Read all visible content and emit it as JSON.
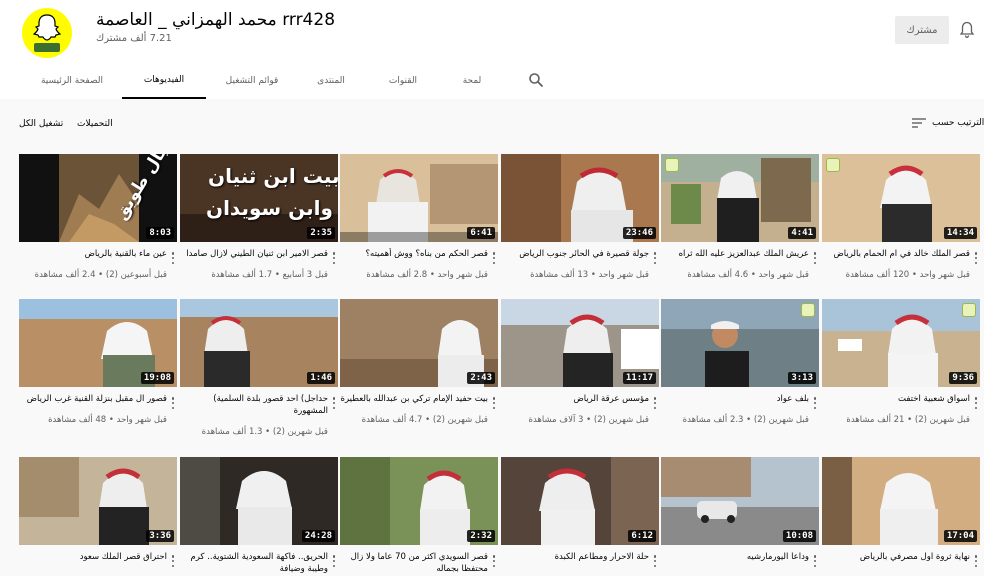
{
  "channel": {
    "name": "rrr428 محمد الهمزاني _ العاصمة",
    "subscribers": "7.21 ألف مشترك",
    "subscribe_label": "مشترك"
  },
  "tabs": [
    {
      "label": "الصفحة الرئيسية",
      "active": false
    },
    {
      "label": "الفيديوهات",
      "active": true
    },
    {
      "label": "قوائم التشغيل",
      "active": false
    },
    {
      "label": "المنتدى",
      "active": false
    },
    {
      "label": "القنوات",
      "active": false
    },
    {
      "label": "لمحة",
      "active": false
    }
  ],
  "toolbar": {
    "uploads_label": "التحميلات",
    "play_all_label": "تشغيل الكل",
    "sort_label": "الترتيب حسب"
  },
  "videos": [
    {
      "title": "عين ماء بالقنية بالرياض",
      "views": "2.4 ألف مشاهدة",
      "age": "قبل أسبوعين (2)",
      "duration": "8:03"
    },
    {
      "title": "قصر الامير ابن ثنيان الطيني لازال صامدا",
      "views": "1.7 ألف مشاهدة",
      "age": "قبل 3 أسابيع",
      "duration": "2:35"
    },
    {
      "title": "قصر الحكم من بناه؟ ووش أهميته؟",
      "views": "2.8 ألف مشاهدة",
      "age": "قبل شهر واحد",
      "duration": "6:41"
    },
    {
      "title": "جولة قصيرة في الحائر جنوب الرياض",
      "views": "13 ألف مشاهدة",
      "age": "قبل شهر واحد",
      "duration": "23:46"
    },
    {
      "title": "عريش الملك عبدالعزيز عليه الله ثراه",
      "views": "4.6 ألف مشاهدة",
      "age": "قبل شهر واحد",
      "duration": "4:41"
    },
    {
      "title": "قصر الملك خالد في ام الحمام بالرياض",
      "views": "120 ألف مشاهدة",
      "age": "قبل شهر واحد",
      "duration": "14:34"
    },
    {
      "title": "قصور ال مقبل بنزلة القنية غرب الرياض",
      "views": "48 ألف مشاهدة",
      "age": "قبل شهر واحد",
      "duration": "19:08"
    },
    {
      "title": "حداجل) احد قصور بلدة السلمية) المشهورة",
      "views": "1.3 ألف مشاهدة",
      "age": "قبل شهرين (2)",
      "duration": "1:46"
    },
    {
      "title": "بيت حفيد الإمام تركي بن عبدالله بالعطيرة",
      "views": "4.7 ألف مشاهدة",
      "age": "قبل شهرين (2)",
      "duration": "2:43"
    },
    {
      "title": "مؤسس عرقة الرياض",
      "views": "3 آلاف مشاهدة",
      "age": "قبل شهرين (2)",
      "duration": "11:17"
    },
    {
      "title": "بلف عواد",
      "views": "2.3 ألف مشاهدة",
      "age": "قبل شهرين (2)",
      "duration": "3:13"
    },
    {
      "title": "اسواق شعبية اختفت",
      "views": "21 ألف مشاهدة",
      "age": "قبل شهرين (2)",
      "duration": "9:36"
    },
    {
      "title": "احتراق قصر الملك سعود",
      "views": "",
      "age": "",
      "duration": "3:36"
    },
    {
      "title": "الحريق.. فاكهة السعودية الشتوية.. كرم وطيبة وضيافة",
      "views": "",
      "age": "",
      "duration": "24:28"
    },
    {
      "title": "قصر السويدي اكثر من 70 عاما ولا زال محتفظا بجماله",
      "views": "",
      "age": "",
      "duration": "2:32"
    },
    {
      "title": "حلة الاحرار ومطاعم الكبدة",
      "views": "",
      "age": "",
      "duration": "6:12"
    },
    {
      "title": "وداعا اليورمارشيه",
      "views": "",
      "age": "",
      "duration": "10:08"
    },
    {
      "title": "نهاية ثروة اول مصرفي بالرياض",
      "views": "",
      "age": "",
      "duration": "17:04"
    }
  ],
  "thumb_overlays": {
    "v0": "جبال طويق",
    "v1a": "بيت ابن ثنيان",
    "v1b": "وابن سويدان"
  },
  "colors": {
    "accent": "#030303",
    "secondary_text": "#606060",
    "page_bg": "#f9f9f9",
    "avatar_yellow": "#fffc00"
  }
}
